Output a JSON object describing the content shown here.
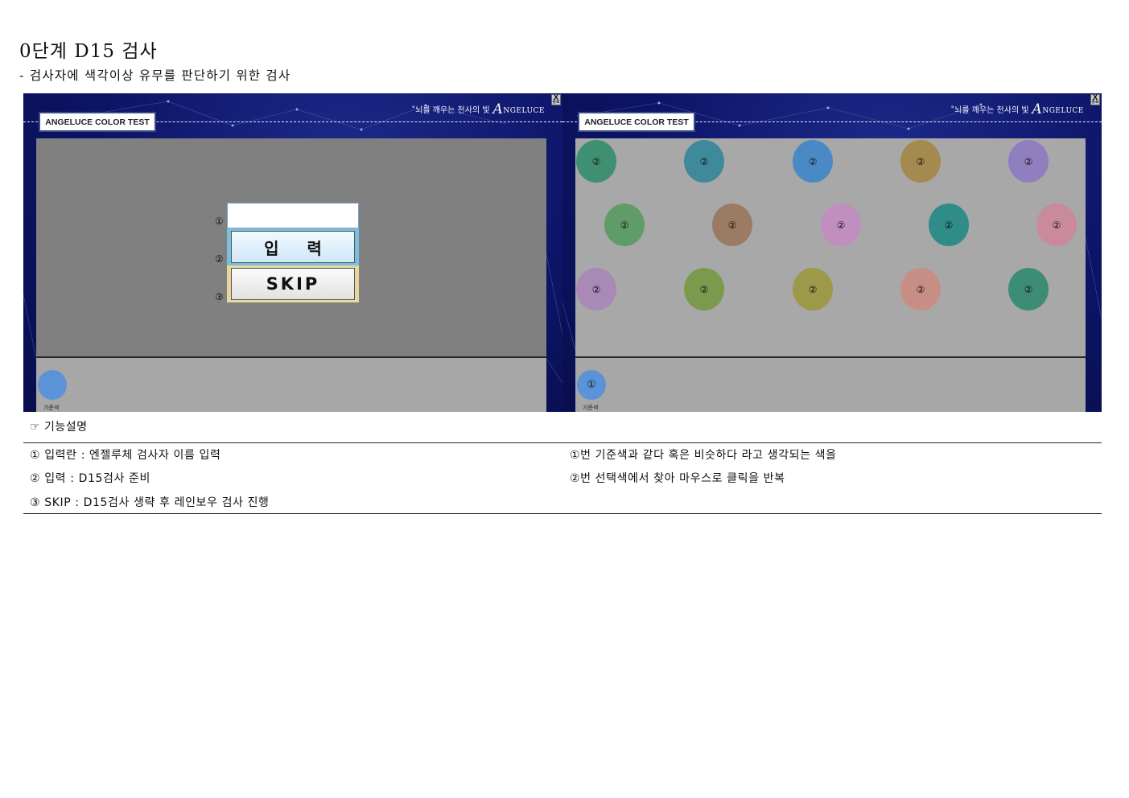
{
  "doc": {
    "title": "0단계 D15 검사",
    "subtitle": "- 검사자에 색각이상 유무를 판단하기 위한 검사"
  },
  "app": {
    "name": "ANGELUCE COLOR TEST",
    "slogan": "˚뇌를 깨우는 천사의 빛",
    "logo_text": "NGELUCE",
    "close_label": "X",
    "close_sub": "종료"
  },
  "left_screen": {
    "markers": [
      "①",
      "②",
      "③"
    ],
    "input_value": "",
    "enter_label": "입 력",
    "skip_label": "SKIP",
    "reference_label": "기준색"
  },
  "right_screen": {
    "dot_mark": "②",
    "reference_mark": "①",
    "reference_label": "기준색",
    "dot_colors": [
      "#3f8f72",
      "#3f8a9a",
      "#4a8ac4",
      "#a48a4e",
      "#8f7fbf",
      "#5f9c68",
      "#9c7b64",
      "#c18fbf",
      "#2f8c86",
      "#c98a9e",
      "#a98ab6",
      "#7b9a4e",
      "#9c9a48",
      "#c78e86",
      "#3d8d76"
    ],
    "reference_color": "#5b93d8"
  },
  "description": {
    "heading": "☞ 기능설명",
    "left_items": [
      "①  입력란 :  엔젤루체 검사자 이름 입력",
      "②  입력 : D15검사 준비",
      "③  SKIP : D15검사 생략 후 레인보우 검사 진행"
    ],
    "right_items": [
      "①번 기준색과 같다 혹은 비슷하다 라고 생각되는 색을",
      "②번 선택색에서 찾아 마우스로 클릭을 반복"
    ]
  }
}
